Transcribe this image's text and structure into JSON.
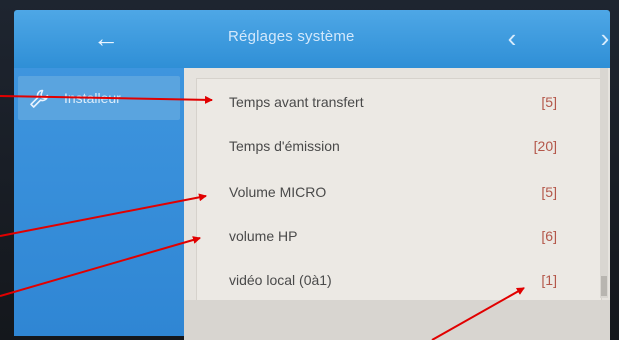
{
  "header": {
    "back_icon": "←",
    "title": "Réglages système",
    "prev_icon": "‹",
    "next_icon": "›"
  },
  "sidebar": {
    "items": [
      {
        "icon": "wrench-icon",
        "label": "Installeur"
      }
    ]
  },
  "settings": {
    "rows": [
      {
        "label": "Temps avant transfert",
        "value": "[5]"
      },
      {
        "label": "Temps d'émission",
        "value": "[20]"
      },
      {
        "label": "Volume MICRO",
        "value": "[5]"
      },
      {
        "label": "volume HP",
        "value": "[6]"
      },
      {
        "label": "vidéo local (0à1)",
        "value": "[1]"
      }
    ]
  },
  "colors": {
    "accent_blue": "#3e95de",
    "value_red": "#b4574a",
    "annotation_arrow": "#e10000"
  }
}
